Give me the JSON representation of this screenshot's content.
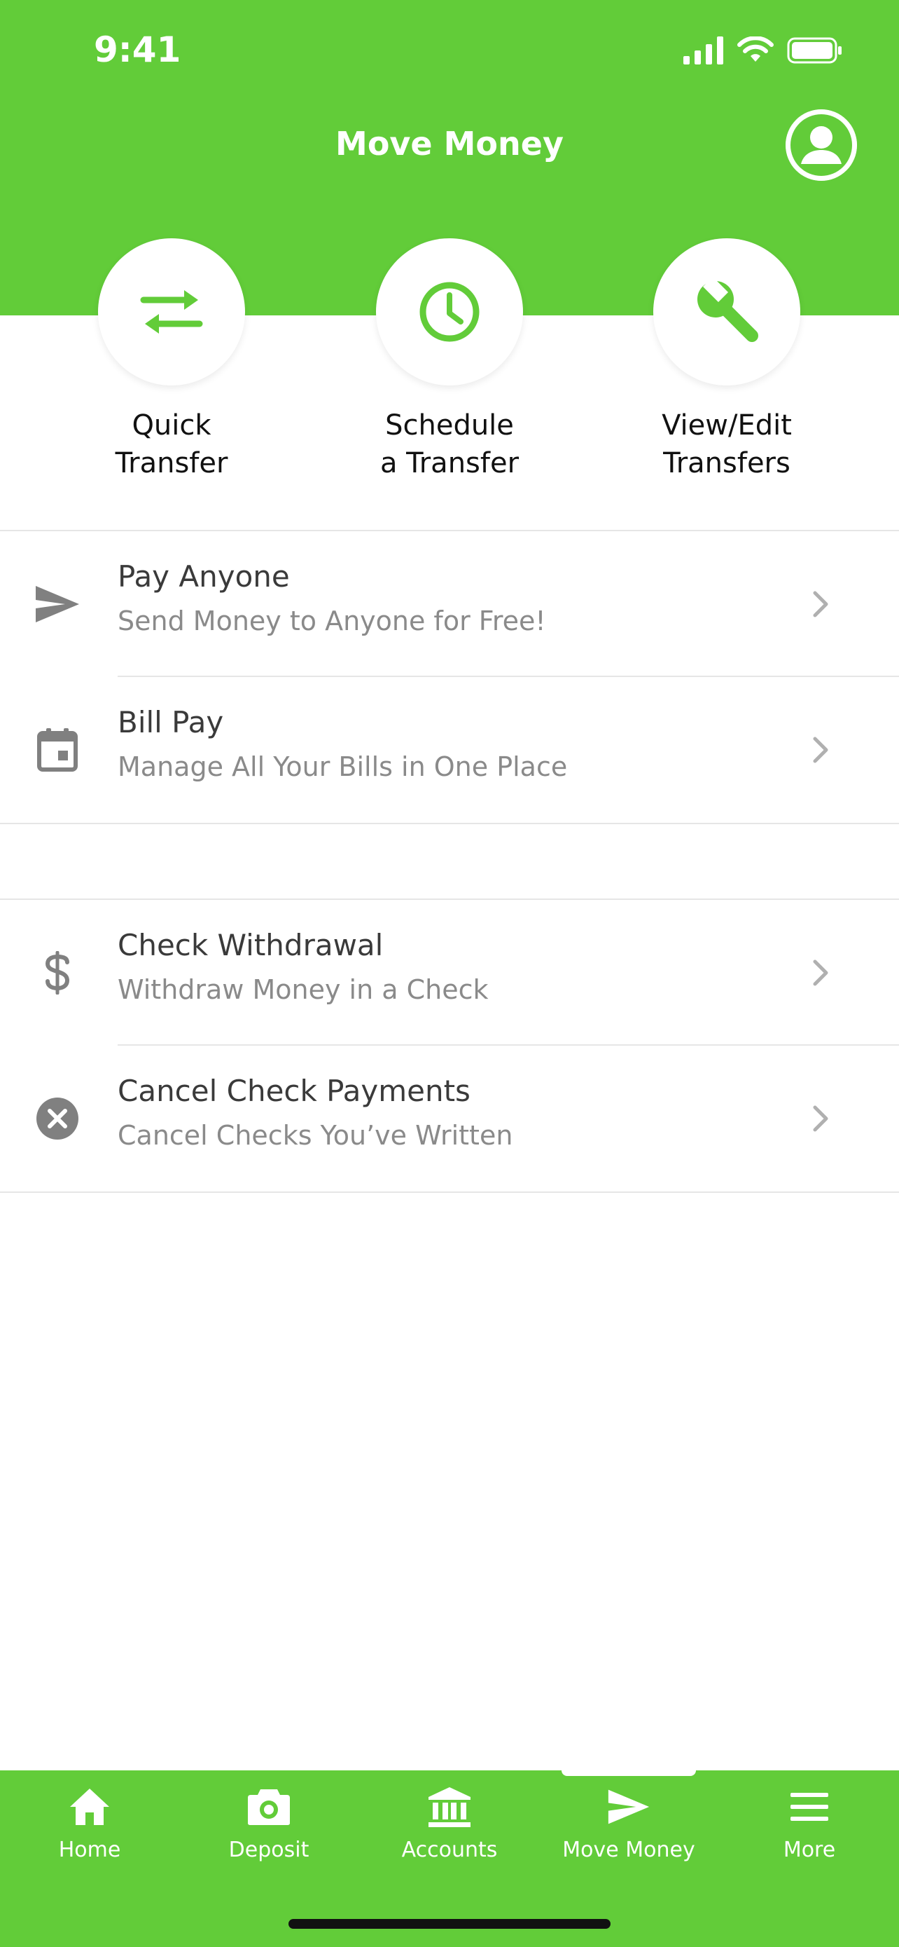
{
  "status_bar": {
    "time": "9:41"
  },
  "header": {
    "title": "Move Money"
  },
  "colors": {
    "brand": "#62cc39",
    "icon_gray": "#808080",
    "text_primary": "#3a3a3a",
    "text_secondary": "#8a8a8a"
  },
  "quick_actions": [
    {
      "label": "Quick Transfer",
      "icon": "transfer-arrows-icon"
    },
    {
      "label": "Schedule\na Transfer",
      "icon": "clock-icon"
    },
    {
      "label": "View/Edit\nTransfers",
      "icon": "wrench-icon"
    }
  ],
  "group1": [
    {
      "title": "Pay Anyone",
      "subtitle": "Send Money to Anyone for Free!",
      "icon": "paper-plane-icon"
    },
    {
      "title": "Bill Pay",
      "subtitle": "Manage All Your Bills in One Place",
      "icon": "calendar-icon"
    }
  ],
  "group2": [
    {
      "title": "Check Withdrawal",
      "subtitle": "Withdraw Money in a Check",
      "icon": "dollar-icon"
    },
    {
      "title": "Cancel Check Payments",
      "subtitle": "Cancel Checks You’ve Written",
      "icon": "cancel-circle-icon"
    }
  ],
  "tabs": [
    {
      "label": "Home",
      "icon": "home-icon",
      "selected": false
    },
    {
      "label": "Deposit",
      "icon": "camera-icon",
      "selected": false
    },
    {
      "label": "Accounts",
      "icon": "bank-icon",
      "selected": false
    },
    {
      "label": "Move Money",
      "icon": "paper-plane-icon",
      "selected": true
    },
    {
      "label": "More",
      "icon": "menu-icon",
      "selected": false
    }
  ]
}
